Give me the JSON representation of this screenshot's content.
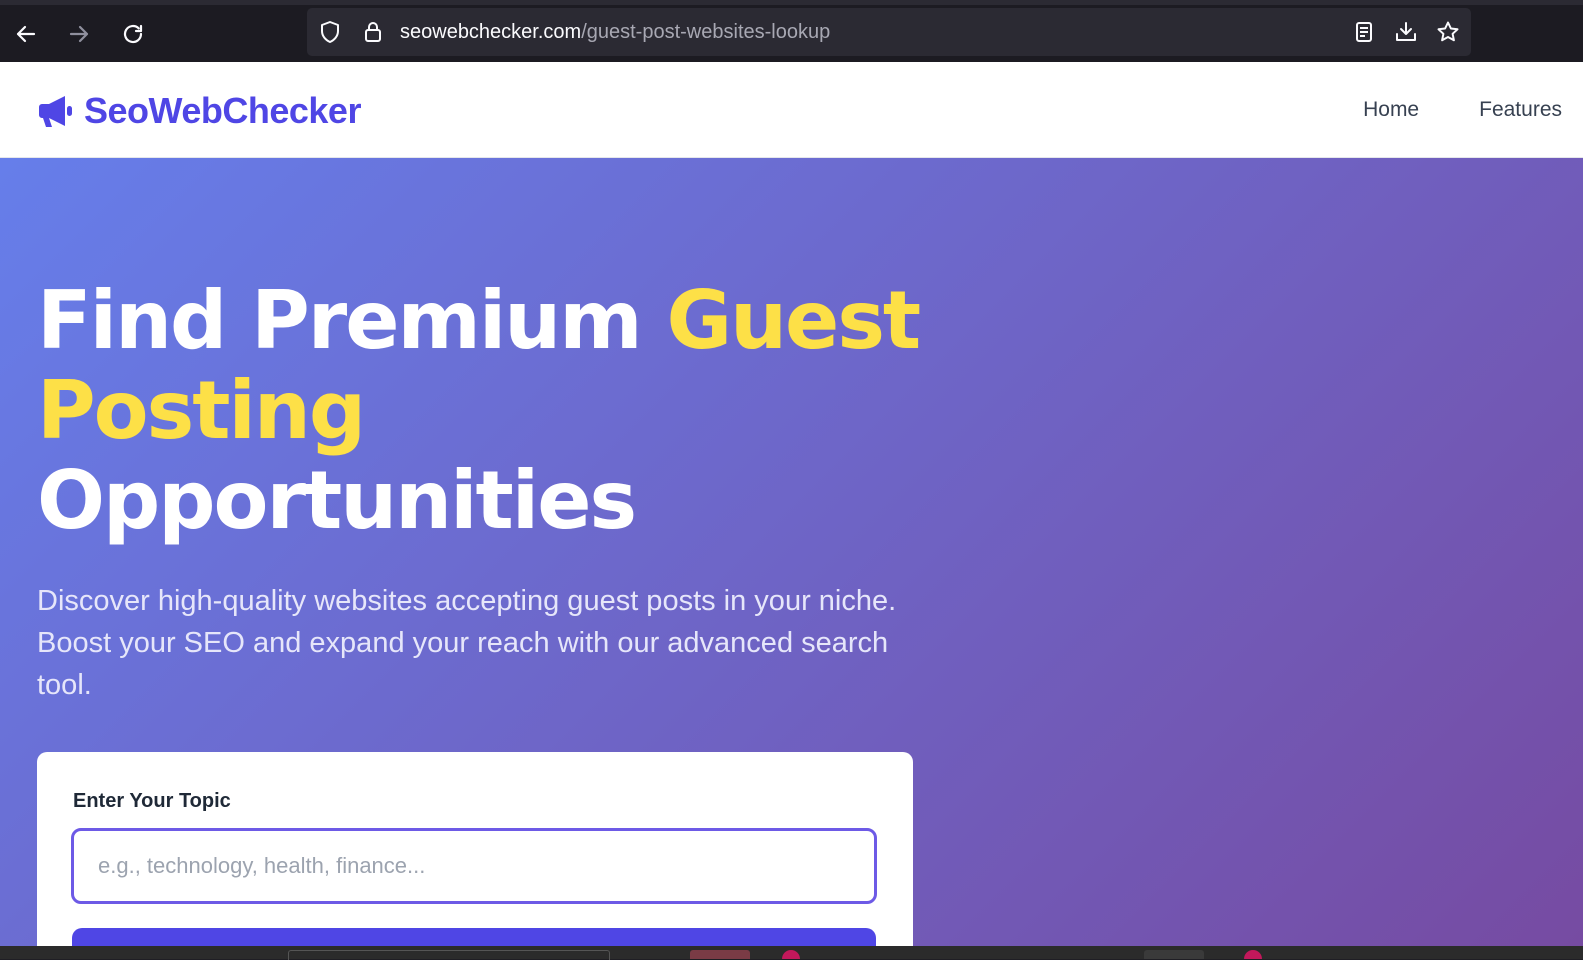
{
  "browser": {
    "url_host": "seowebchecker.com",
    "url_path": "/guest-post-websites-lookup",
    "icons": [
      "back-arrow-icon",
      "forward-arrow-icon",
      "reload-icon",
      "shield-icon",
      "lock-icon",
      "reader-view-icon",
      "download-icon",
      "bookmark-star-icon"
    ]
  },
  "header": {
    "logo_icon": "megaphone-icon",
    "logo_text": "SeoWebChecker",
    "nav": [
      {
        "label": "Home"
      },
      {
        "label": "Features"
      }
    ]
  },
  "hero": {
    "title_part1": "Find Premium ",
    "title_accent": "Guest Posting",
    "title_part2": "Opportunities",
    "subtitle": "Discover high-quality websites accepting guest posts in your niche. Boost your SEO and expand your reach with our advanced search tool."
  },
  "search": {
    "label": "Enter Your Topic",
    "value": "",
    "placeholder": "e.g., technology, health, finance..."
  },
  "colors": {
    "brand": "#4f46e5",
    "accent": "#fde047",
    "gradient_start": "#667eea",
    "gradient_end": "#764ba2"
  }
}
